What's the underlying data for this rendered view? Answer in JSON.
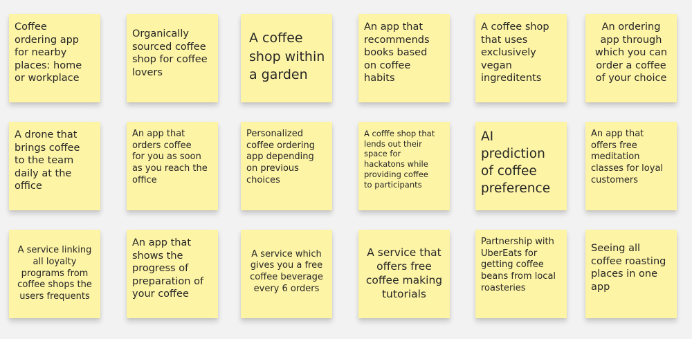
{
  "board": {
    "background": "#f2f2f2",
    "note_color": "#fdf4a6",
    "notes": [
      {
        "text": "Coffee\nordering app\nfor nearby\nplaces: home\nor workplace"
      },
      {
        "text": "Organically\nsourced coffee\nshop for coffee\nlovers"
      },
      {
        "text": "A coffee\nshop within\na garden"
      },
      {
        "text": "An app that\nrecommends\nbooks based\non coffee\nhabits"
      },
      {
        "text": "A coffee shop\nthat uses\nexclusively\nvegan\ningreditents"
      },
      {
        "text": "An ordering\napp through\nwhich you can\norder a coffee\nof your choice"
      },
      {
        "text": "A drone that\nbrings coffee\nto the team\ndaily at the\noffice"
      },
      {
        "text": "An app that\norders coffee\nfor you as soon\nas you reach the\noffice"
      },
      {
        "text": "Personalized\ncoffee ordering\napp depending\non previous\nchoices"
      },
      {
        "text": "A cofffe shop that\nlends out their\nspace for\nhackatons while\nproviding coffee\nto participants"
      },
      {
        "text": "AI\nprediction\nof coffee\npreference"
      },
      {
        "text": "An app that\noffers free\nmeditation\nclasses for loyal\ncustomers"
      },
      {
        "text": "A service linking\nall loyalty\nprograms from\ncoffee shops the\nusers frequents"
      },
      {
        "text": "An app that\nshows the\nprogress of\npreparation of\nyour coffee"
      },
      {
        "text": "A service which\ngives you a free\ncoffee beverage\nevery 6 orders"
      },
      {
        "text": "A service that\noffers free\ncoffee making\ntutorials"
      },
      {
        "text": "Partnership with\nUberEats for\ngetting coffee\nbeans from local\nroasteries"
      },
      {
        "text": "Seeing all\ncoffee roasting\nplaces in one\napp"
      }
    ]
  }
}
